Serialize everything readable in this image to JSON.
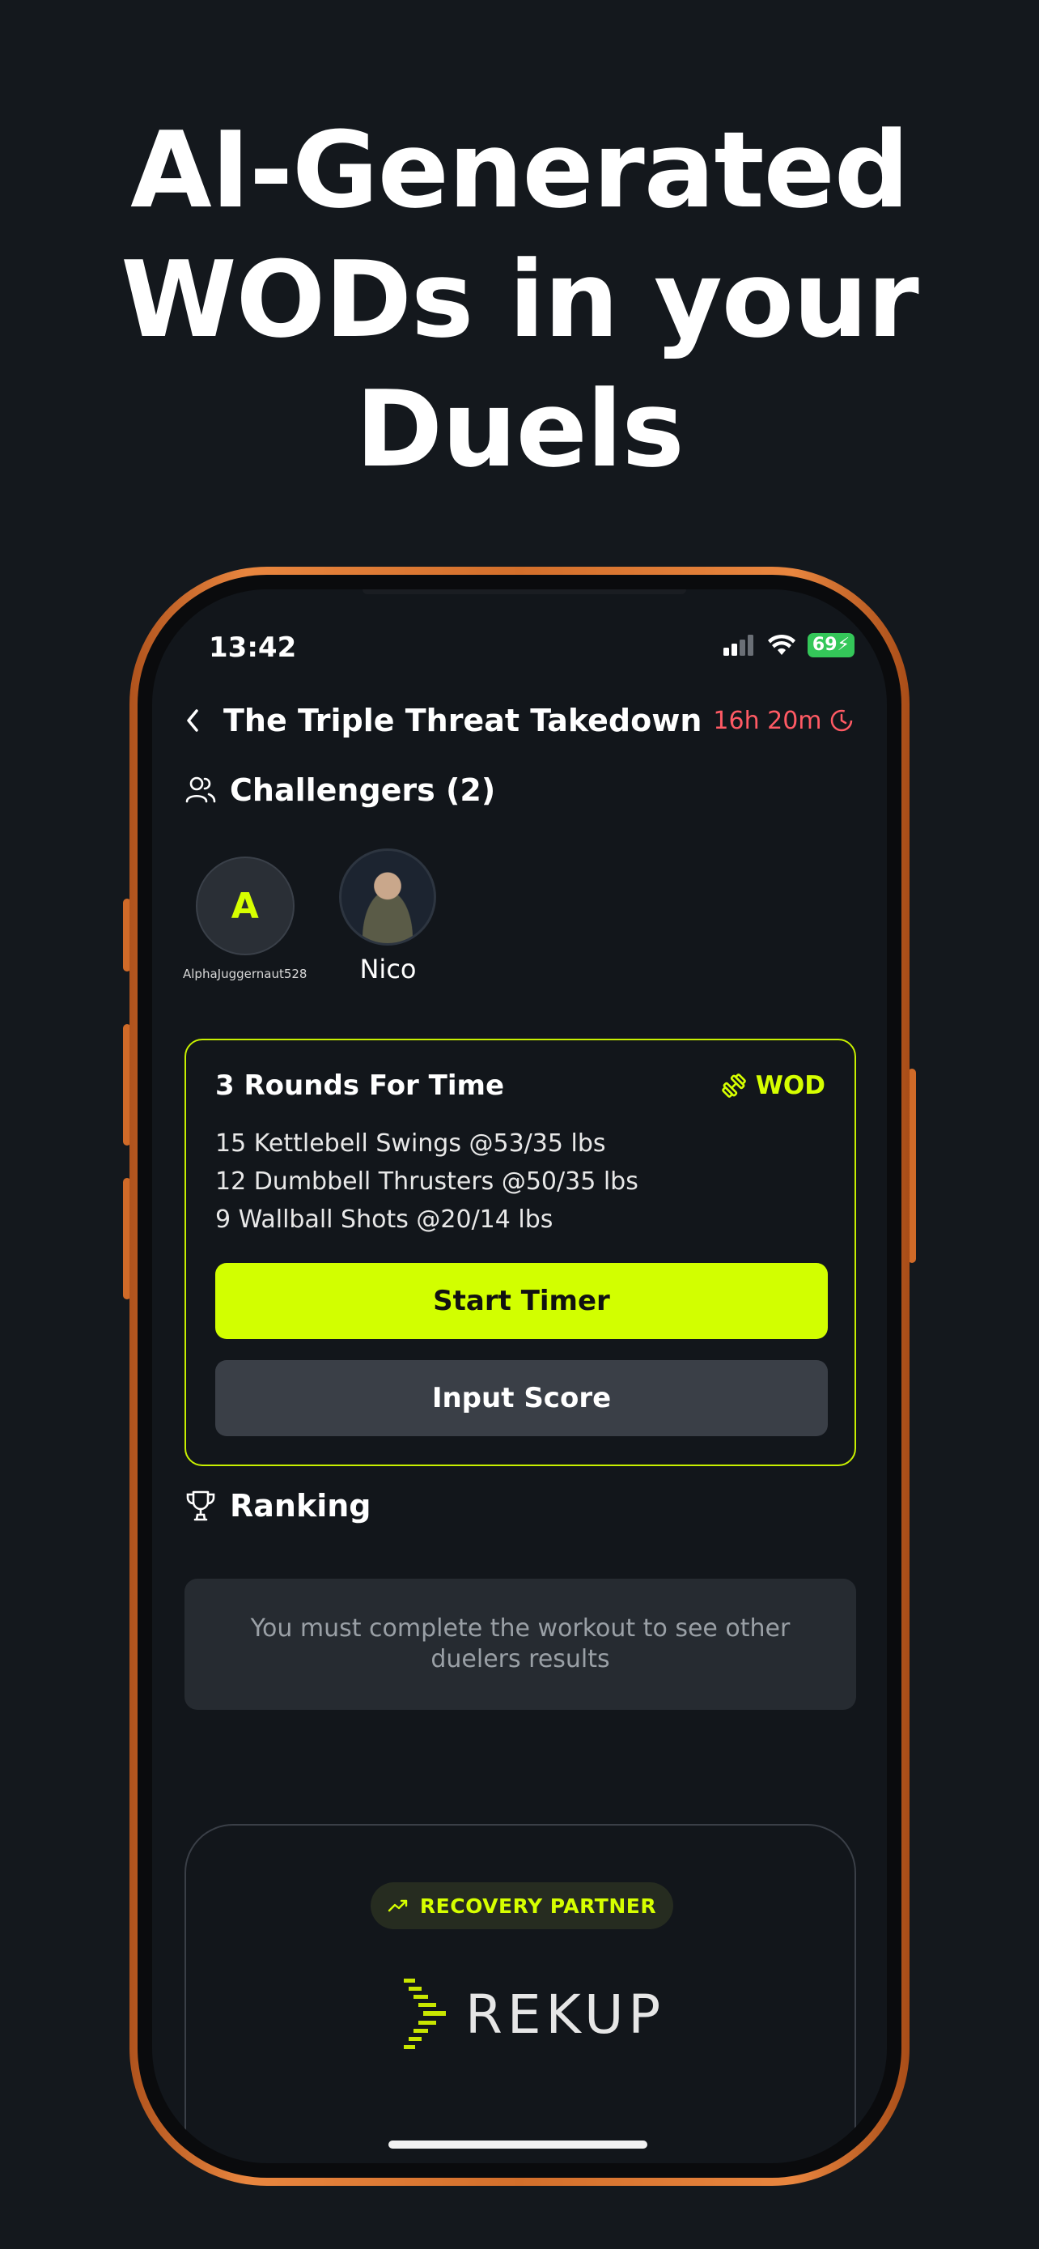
{
  "headline": [
    "AI-Generated",
    "WODs in your",
    "Duels"
  ],
  "status_bar": {
    "time": "13:42",
    "battery": "69"
  },
  "header": {
    "title": "The Triple Threat Takedown",
    "timer": "16h 20m"
  },
  "challengers": {
    "title": "Challengers (2)",
    "items": [
      {
        "initial": "A",
        "name": "AlphaJuggernaut528"
      },
      {
        "name": "Nico"
      }
    ]
  },
  "wod": {
    "title": "3 Rounds For Time",
    "tag": "WOD",
    "lines": [
      "15 Kettlebell Swings @53/35 lbs",
      "12 Dumbbell Thrusters @50/35 lbs",
      "9 Wallball Shots @20/14 lbs"
    ],
    "start_label": "Start Timer",
    "input_label": "Input Score"
  },
  "ranking": {
    "title": "Ranking",
    "message": "You must complete the workout to see other duelers results"
  },
  "partner": {
    "badge": "RECOVERY PARTNER",
    "logo_text": "REKUP"
  },
  "colors": {
    "accent": "#d2ff00",
    "background": "#12161b",
    "timer": "#ff5a64",
    "frame": "#d36f2b"
  }
}
